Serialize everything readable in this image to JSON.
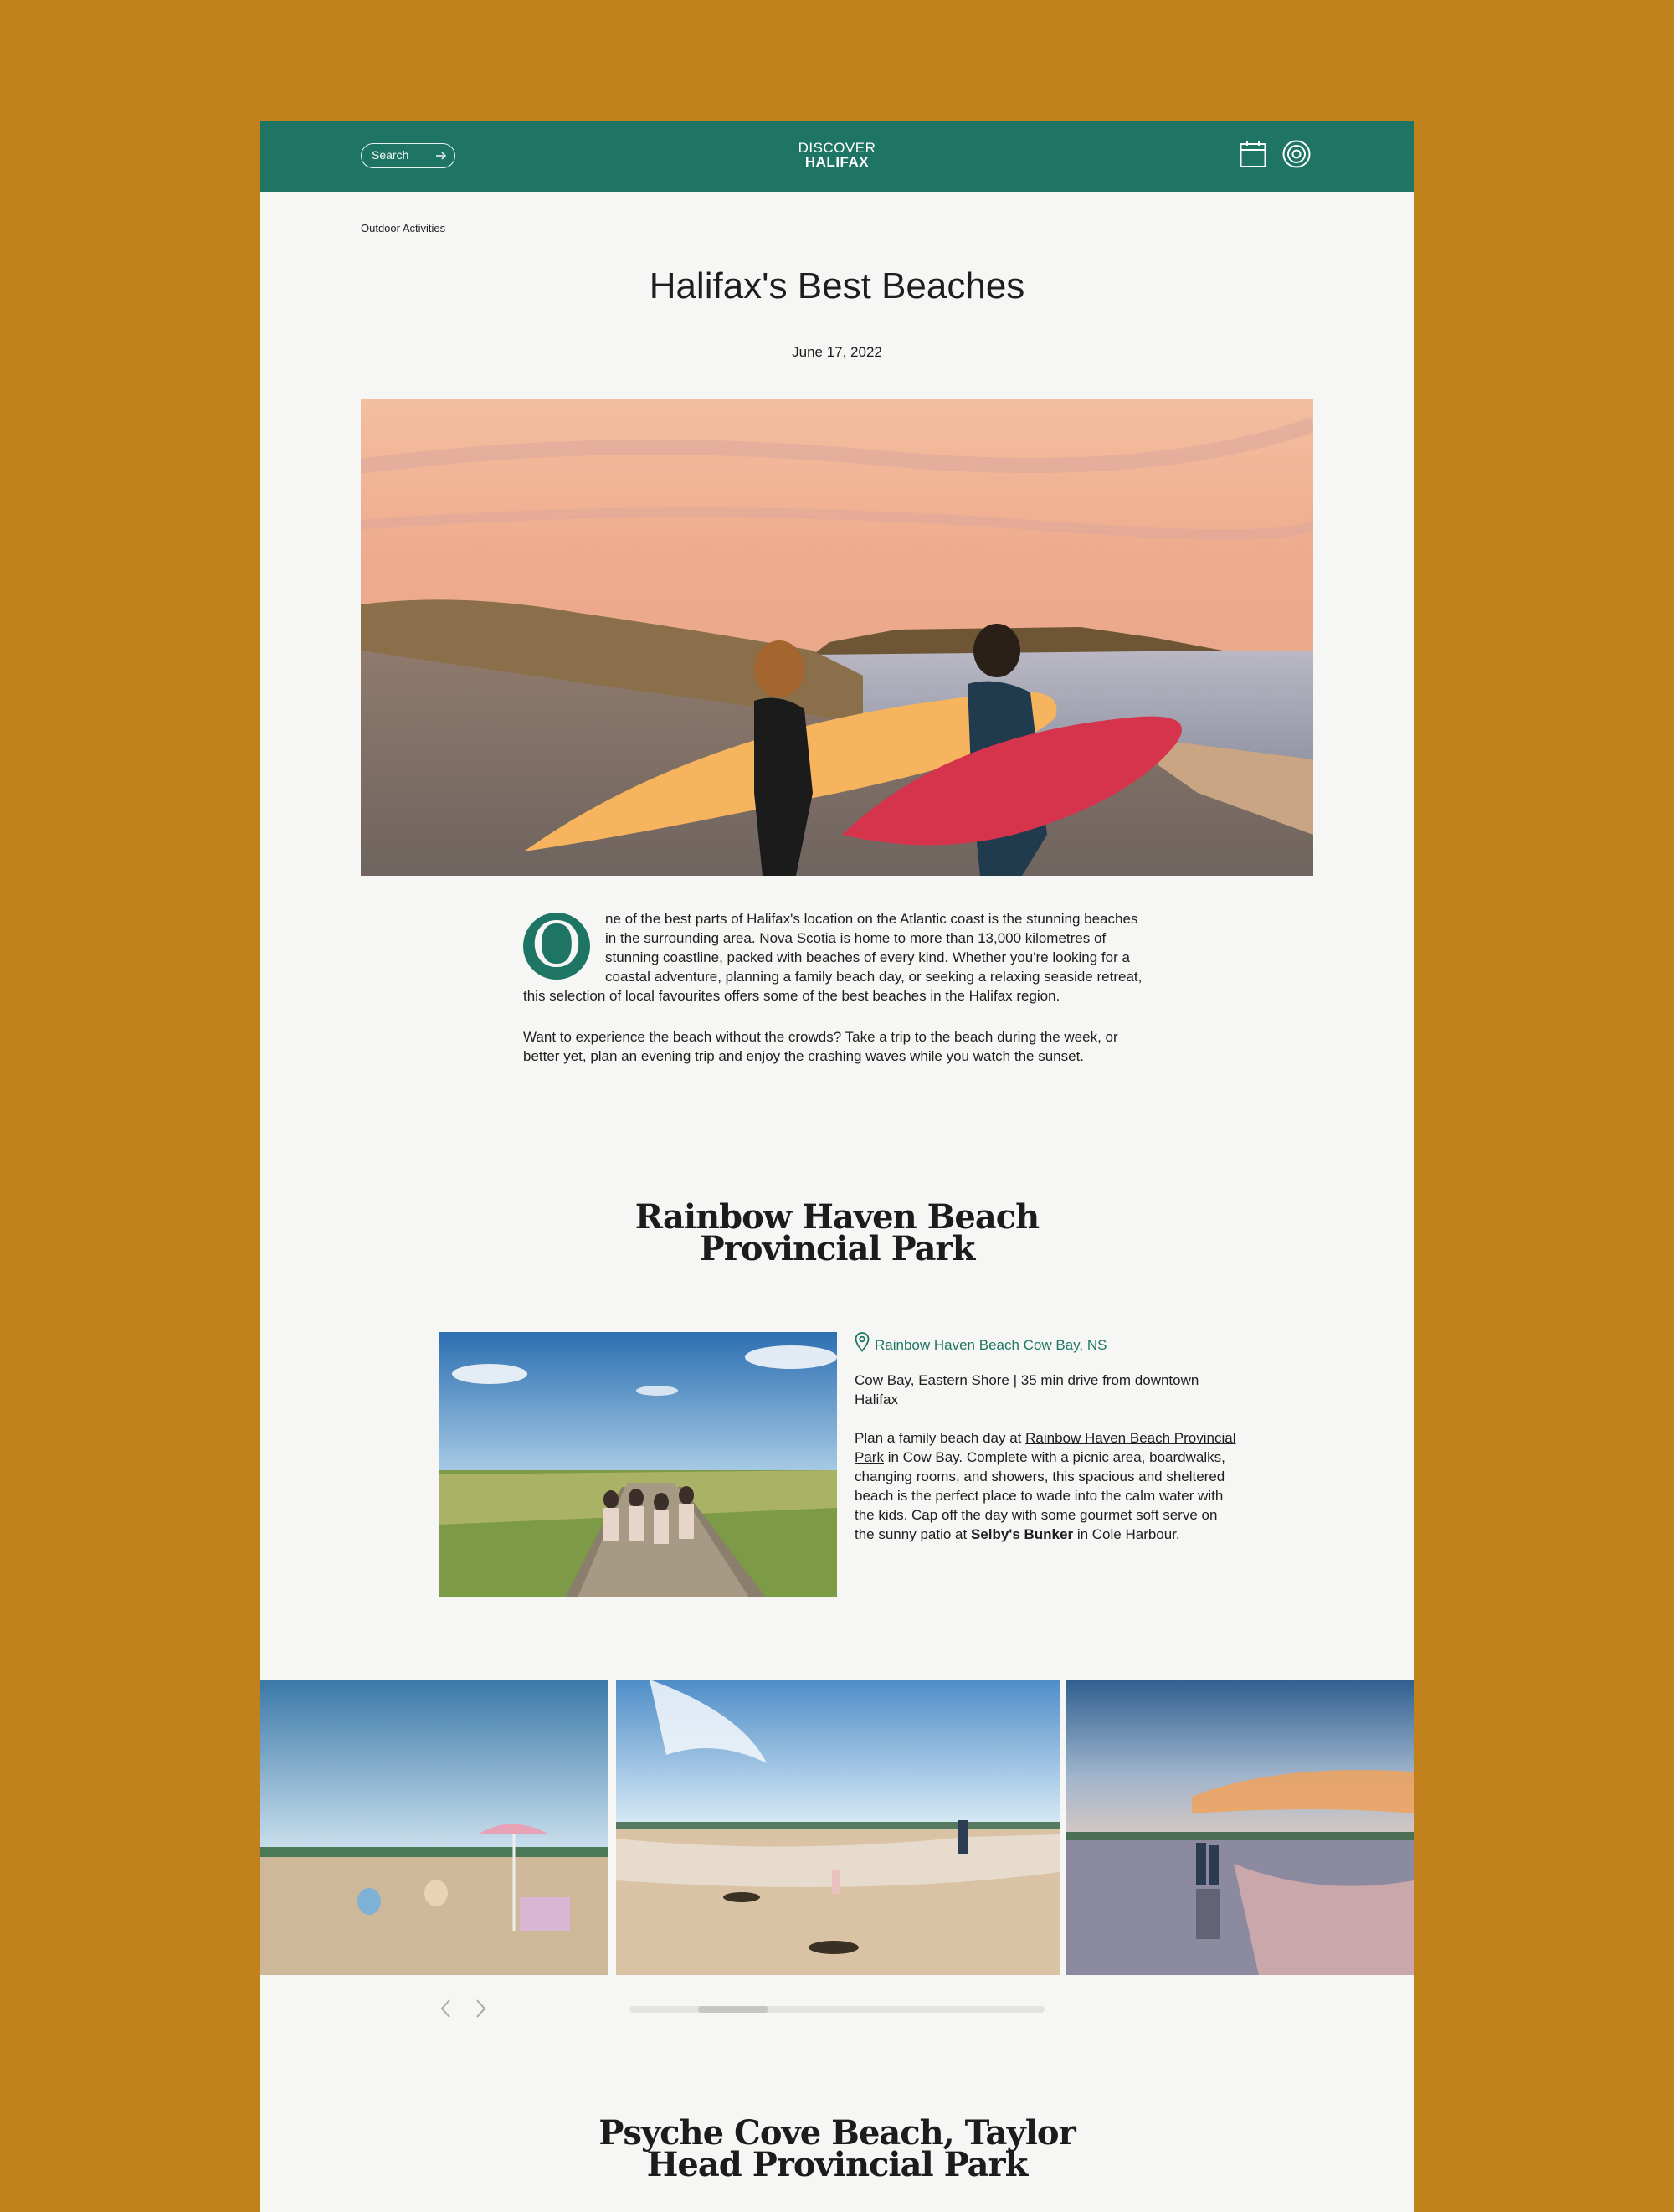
{
  "header": {
    "search_label": "Search",
    "logo_line1": "DISCOVER",
    "logo_line2": "HALIFAX"
  },
  "breadcrumb": "Outdoor Activities",
  "article": {
    "title": "Halifax's Best Beaches",
    "date": "June 17, 2022",
    "dropcap": "O",
    "intro_p1": "ne of the best parts of Halifax's location on the Atlantic coast is the stunning beaches in the surrounding area. Nova Scotia is home to more than 13,000 kilometres of stunning coastline, packed with beaches of every kind. Whether you're looking for a coastal adventure, planning a family beach day, or seeking a relaxing seaside retreat, this selection of local favourites offers some of the best beaches in the Halifax region.",
    "intro_p2_before": "Want to experience the beach without the crowds? Take a trip to the beach during the week, or better yet, plan an evening trip and enjoy the crashing waves while you ",
    "intro_p2_link": "watch the sunset",
    "intro_p2_after": "."
  },
  "section1": {
    "title_line1": "Rainbow Haven Beach",
    "title_line2": "Provincial Park",
    "location_link": "Rainbow Haven Beach Cow Bay, NS",
    "drive_info": "Cow Bay, Eastern Shore | 35 min drive from downtown Halifax",
    "desc_before": "Plan a family beach day at ",
    "desc_link": "Rainbow Haven Beach Provincial Park",
    "desc_middle": " in Cow Bay. Complete with a picnic area, boardwalks, changing rooms, and showers, this spacious and sheltered beach is the perfect place to wade into the calm water with the kids. Cap off the day with some gourmet soft serve on the sunny patio at ",
    "desc_bold": "Selby's Bunker",
    "desc_after": " in Cole Harbour."
  },
  "gallery": {
    "scroll_position": 0.2
  },
  "section2": {
    "title_line1": "Psyche Cove Beach, Taylor",
    "title_line2": "Head Provincial Park"
  },
  "colors": {
    "background": "#c1811c",
    "page": "#f6f7f4",
    "brand_green": "#1f7564"
  },
  "icons": [
    "arrow-right-icon",
    "calendar-icon",
    "target-icon",
    "map-pin-icon",
    "chevron-left-icon",
    "chevron-right-icon"
  ]
}
